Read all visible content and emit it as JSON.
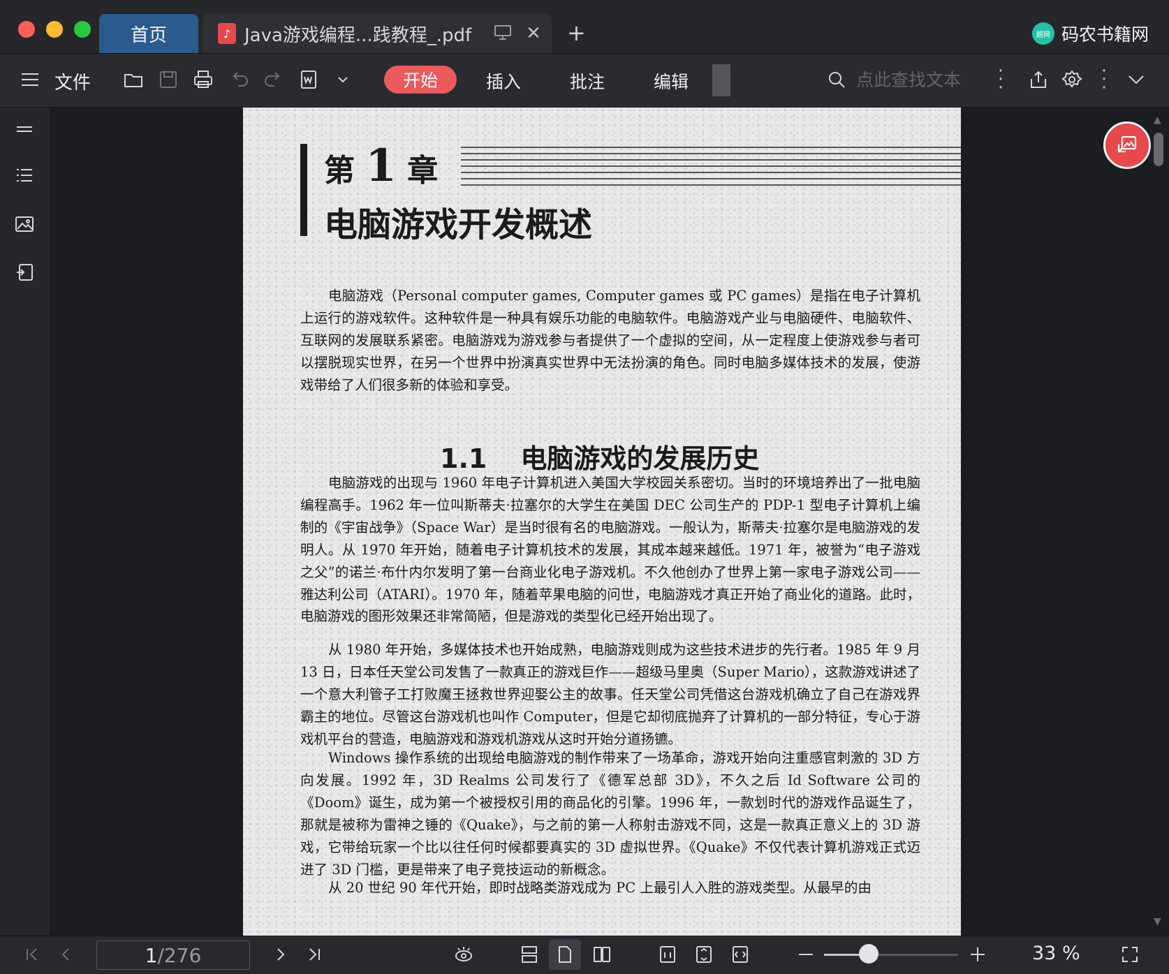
{
  "titlebar": {
    "tabs": [
      {
        "label": "首页"
      },
      {
        "label": "Java游戏编程...践教程_.pdf"
      }
    ],
    "brand": {
      "logo_text": "题网",
      "name": "码农书籍网"
    }
  },
  "toolbar": {
    "file_label": "文件",
    "tabs": [
      "开始",
      "插入",
      "批注",
      "编辑"
    ],
    "active_tab": "开始",
    "search": {
      "placeholder": "点此查找文本"
    }
  },
  "colors": {
    "accent": "#ec5a5c",
    "home_tab": "#2b5a8e"
  },
  "document": {
    "chapter_label": "第",
    "chapter_number": "1",
    "chapter_suffix": "章",
    "chapter_title": "电脑游戏开发概述",
    "intro": "电脑游戏（Personal computer games, Computer games 或 PC games）是指在电子计算机上运行的游戏软件。这种软件是一种具有娱乐功能的电脑软件。电脑游戏产业与电脑硬件、电脑软件、互联网的发展联系紧密。电脑游戏为游戏参与者提供了一个虚拟的空间，从一定程度上使游戏参与者可以摆脱现实世界，在另一个世界中扮演真实世界中无法扮演的角色。同时电脑多媒体技术的发展，使游戏带给了人们很多新的体验和享受。",
    "section_number": "1.1",
    "section_title": "电脑游戏的发展历史",
    "paragraphs": [
      "电脑游戏的出现与 1960 年电子计算机进入美国大学校园关系密切。当时的环境培养出了一批电脑编程高手。1962 年一位叫斯蒂夫·拉塞尔的大学生在美国 DEC 公司生产的 PDP-1 型电子计算机上编制的《宇宙战争》（Space War）是当时很有名的电脑游戏。一般认为，斯蒂夫·拉塞尔是电脑游戏的发明人。从 1970 年开始，随着电子计算机技术的发展，其成本越来越低。1971 年，被誉为“电子游戏之父”的诺兰·布什内尔发明了第一台商业化电子游戏机。不久他创办了世界上第一家电子游戏公司——雅达利公司（ATARI）。1970 年，随着苹果电脑的问世，电脑游戏才真正开始了商业化的道路。此时，电脑游戏的图形效果还非常简陋，但是游戏的类型化已经开始出现了。",
      "从 1980 年开始，多媒体技术也开始成熟，电脑游戏则成为这些技术进步的先行者。1985 年 9 月 13 日，日本任天堂公司发售了一款真正的游戏巨作——超级马里奥（Super Mario），这款游戏讲述了一个意大利管子工打败魔王拯救世界迎娶公主的故事。任天堂公司凭借这台游戏机确立了自己在游戏界霸主的地位。尽管这台游戏机也叫作 Computer，但是它却彻底抛弃了计算机的一部分特征，专心于游戏机平台的营造，电脑游戏和游戏机游戏从这时开始分道扬镳。",
      "Windows 操作系统的出现给电脑游戏的制作带来了一场革命，游戏开始向注重感官刺激的 3D 方向发展。1992 年，3D Realms 公司发行了《德军总部 3D》，不久之后 Id Software 公司的《Doom》诞生，成为第一个被授权引用的商品化的引擎。1996 年，一款划时代的游戏作品诞生了，那就是被称为雷神之锤的《Quake》，与之前的第一人称射击游戏不同，这是一款真正意义上的 3D 游戏，它带给玩家一个比以往任何时候都要真实的 3D 虚拟世界。《Quake》不仅代表计算机游戏正式迈进了 3D 门槛，更是带来了电子竞技运动的新概念。",
      "从 20 世纪 90 年代开始，即时战略类游戏成为 PC 上最引人入胜的游戏类型。从最早的由"
    ]
  },
  "status": {
    "current_page": "1",
    "total_pages": "/276",
    "zoom": "33 %",
    "zoom_fraction": 0.33
  }
}
